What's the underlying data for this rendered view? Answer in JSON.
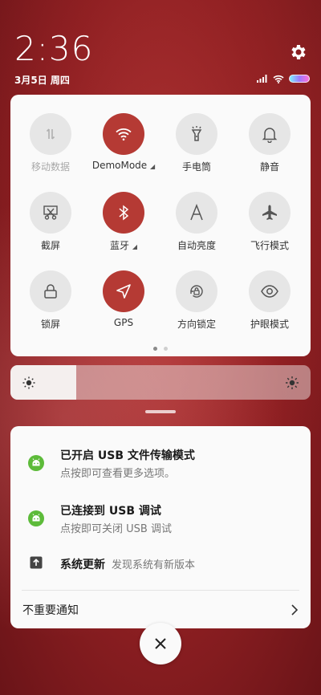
{
  "status": {
    "time": "2:36",
    "date": "3月5日 周四",
    "icons": [
      "signal-icon",
      "wifi-icon",
      "battery-icon"
    ]
  },
  "quick_settings": {
    "tiles": [
      {
        "label": "移动数据",
        "icon": "mobile-data-icon",
        "active": false,
        "disabled": true
      },
      {
        "label": "DemoMode",
        "icon": "wifi-icon",
        "active": true,
        "expandable": true
      },
      {
        "label": "手电筒",
        "icon": "flashlight-icon",
        "active": false
      },
      {
        "label": "静音",
        "icon": "bell-icon",
        "active": false
      },
      {
        "label": "截屏",
        "icon": "screenshot-icon",
        "active": false
      },
      {
        "label": "蓝牙",
        "icon": "bluetooth-icon",
        "active": true,
        "expandable": true
      },
      {
        "label": "自动亮度",
        "icon": "auto-brightness-icon",
        "active": false
      },
      {
        "label": "飞行模式",
        "icon": "airplane-icon",
        "active": false
      },
      {
        "label": "锁屏",
        "icon": "lock-icon",
        "active": false
      },
      {
        "label": "GPS",
        "icon": "location-icon",
        "active": true
      },
      {
        "label": "方向锁定",
        "icon": "rotation-lock-icon",
        "active": false
      },
      {
        "label": "护眼模式",
        "icon": "eye-icon",
        "active": false
      }
    ],
    "pages": 2,
    "current_page": 1
  },
  "brightness": {
    "level": 0.22
  },
  "notifications": [
    {
      "icon": "android-icon",
      "title": "已开启 USB 文件传输模式",
      "subtitle": "点按即可查看更多选项。"
    },
    {
      "icon": "android-icon",
      "title": "已连接到 USB 调试",
      "subtitle": "点按即可关闭 USB 调试"
    },
    {
      "icon": "system-update-icon",
      "title": "系统更新",
      "subtitle": "发现系统有新版本"
    }
  ],
  "unimportant_label": "不重要通知",
  "colors": {
    "accent_active": "#b53a34",
    "tile_inactive": "#e6e6e6",
    "android_green": "#5dbb3a"
  }
}
